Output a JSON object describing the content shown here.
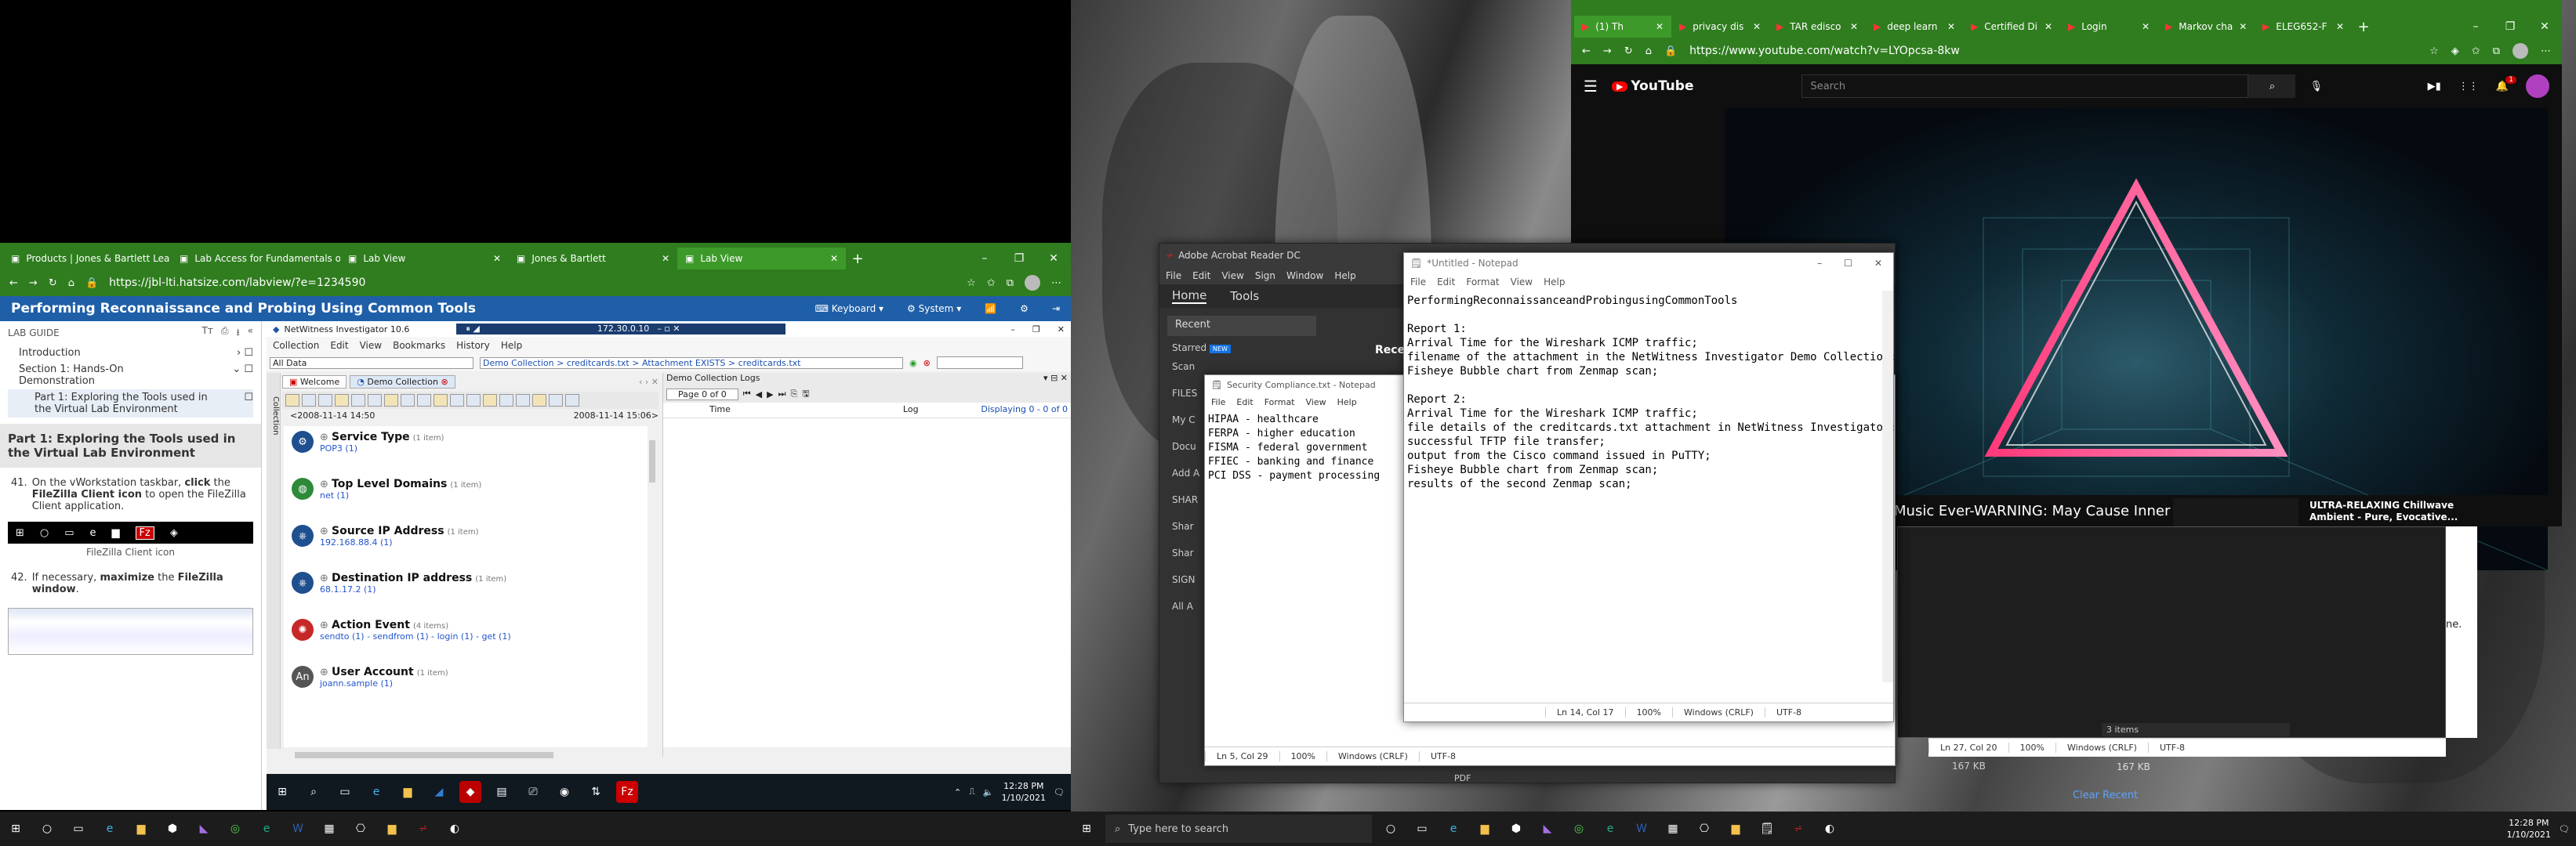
{
  "left_browser": {
    "tabs": [
      {
        "label": "Products | Jones & Bartlett Lea",
        "active": false
      },
      {
        "label": "Lab Access for Fundamentals o",
        "active": false
      },
      {
        "label": "Lab View",
        "active": false
      },
      {
        "label": "Jones & Bartlett",
        "active": false
      },
      {
        "label": "Lab View",
        "active": true
      }
    ],
    "url": "https://jbl-lti.hatsize.com/labview/?e=1234590",
    "page_title": "Performing Reconnaissance and Probing Using Common Tools",
    "keyboard_label": "Keyboard",
    "system_label": "System",
    "lab_guide": {
      "header": "LAB GUIDE",
      "nav": [
        {
          "label": "Introduction"
        },
        {
          "label": "Section 1: Hands-On Demonstration"
        },
        {
          "label": "Part 1: Exploring the Tools used in the Virtual Lab Environment"
        }
      ],
      "section_heading": "Part 1: Exploring the Tools used in the Virtual Lab Environment",
      "step41_num": "41.",
      "step41_a": "On the vWorkstation taskbar, ",
      "step41_b": "click",
      "step41_c": " the ",
      "step41_d": "FileZilla Client icon",
      "step41_e": " to open the FileZilla Client application.",
      "fig_caption": "FileZilla Client icon",
      "step42_num": "42.",
      "step42_a": "If necessary, ",
      "step42_b": "maximize",
      "step42_c": " the ",
      "step42_d": "FileZilla window",
      "step42_e": "."
    }
  },
  "netwitness": {
    "title": "NetWitness Investigator 10.6",
    "remote_ip": "172.30.0.10",
    "menu": [
      "Collection",
      "Edit",
      "View",
      "Bookmarks",
      "History",
      "Help"
    ],
    "filter_value": "All Data",
    "breadcrumb": [
      "Demo Collection",
      "creditcards.txt",
      "Attachment EXISTS",
      "creditcards.txt"
    ],
    "doc_tabs": [
      "Welcome",
      "Demo Collection"
    ],
    "time_start": "2008-11-14 14:50",
    "time_end": "2008-11-14 15:06",
    "page_label": "Page 0 of 0",
    "logs_title": "Demo Collection Logs",
    "log_col_time": "Time",
    "log_col_log": "Log",
    "displaying": "Displaying 0 - 0 of 0",
    "collection_tab": "Collection",
    "meta": [
      {
        "title": "Service Type",
        "count": "(1 item)",
        "values": "POP3 (1)",
        "icon": "gear-icon"
      },
      {
        "title": "Top Level Domains",
        "count": "(1 item)",
        "values": "net (1)",
        "icon": "globe-icon"
      },
      {
        "title": "Source IP Address",
        "count": "(1 item)",
        "values": "192.168.88.4 (1)",
        "icon": "network-icon"
      },
      {
        "title": "Destination IP address",
        "count": "(1 item)",
        "values": "68.1.17.2 (1)",
        "icon": "network-icon"
      },
      {
        "title": "Action Event",
        "count": "(4 items)",
        "values": "sendto (1) - sendfrom (1) - login (1) - get (1)",
        "icon": "event-icon"
      },
      {
        "title": "User Account",
        "count": "(1 item)",
        "values": "joann.sample (1)",
        "icon": "user-icon"
      }
    ]
  },
  "vm_taskbar": {
    "time": "12:28 PM",
    "date": "1/10/2021"
  },
  "host_taskbar": {
    "time": "12:28 PM",
    "date": "1/10/2021",
    "search_placeholder": "Type here to search"
  },
  "right_browser": {
    "tabs": [
      {
        "label": "(1) Th",
        "active": true
      },
      {
        "label": "privacy dis",
        "active": false
      },
      {
        "label": "TAR edisco",
        "active": false
      },
      {
        "label": "deep learn",
        "active": false
      },
      {
        "label": "Certified Di",
        "active": false
      },
      {
        "label": "Login",
        "active": false
      },
      {
        "label": "Markov cha",
        "active": false
      },
      {
        "label": "ELEG652-F",
        "active": false
      }
    ],
    "url": "https://www.youtube.com/watch?v=LYOpcsa-8kw",
    "search_placeholder": "Search",
    "notif_count": "1",
    "brand": "YouTube",
    "video_title": "Music Ever-WARNING: May Cause Inner",
    "side_title_1": "ULTRA-RELAXING Chillwave",
    "side_title_2": "Ambient - Pure, Evocative...",
    "partial_text": "ne."
  },
  "acrobat": {
    "title": "Adobe Acrobat Reader DC",
    "menu": [
      "File",
      "Edit",
      "View",
      "Sign",
      "Window",
      "Help"
    ],
    "nav_home": "Home",
    "nav_tools": "Tools",
    "recent": "Recent",
    "starred": "Starred",
    "new_badge": "NEW",
    "side_items": [
      "Scan",
      "FILES",
      "My C",
      "Docu",
      "Add A",
      "SHAR",
      "Shar",
      "Shar",
      "SIGN",
      "All A"
    ],
    "rec_label": "Rece",
    "pdf_label": "PDF",
    "size_label": "167 KB",
    "clear_recent": "Clear Recent"
  },
  "notepad_security": {
    "title": "Security Compliance.txt - Notepad",
    "menu": [
      "File",
      "Edit",
      "Format",
      "View",
      "Help"
    ],
    "lines": [
      "HIPAA - healthcare",
      "FERPA - higher education",
      "FISMA - federal government",
      "FFIEC - banking and finance",
      "PCI DSS - payment processing"
    ],
    "status": [
      "Ln 5, Col 29",
      "100%",
      "Windows (CRLF)",
      "UTF-8"
    ]
  },
  "notepad_untitled": {
    "title": "*Untitled - Notepad",
    "menu": [
      "File",
      "Edit",
      "Format",
      "View",
      "Help"
    ],
    "lines": [
      "PerformingReconnaissanceandProbingusingCommonTools",
      "",
      "Report 1:",
      "Arrival Time for the Wireshark ICMP traffic;",
      "filename of the attachment in the NetWitness Investigator Demo Collection;",
      "Fisheye Bubble chart from Zenmap scan;",
      "",
      "Report 2:",
      "Arrival Time for the Wireshark ICMP traffic;",
      "file details of the creditcards.txt attachment in NetWitness Investigator;",
      "successful TFTP file transfer;",
      "output from the Cisco command issued in PuTTY;",
      "Fisheye Bubble chart from Zenmap scan;",
      "results of the second Zenmap scan;"
    ],
    "status": [
      "Ln 14, Col 17",
      "100%",
      "Windows (CRLF)",
      "UTF-8"
    ]
  },
  "back_notepad": {
    "status": [
      "Ln 27, Col 20",
      "100%",
      "Windows (CRLF)",
      "UTF-8"
    ],
    "items_label": "3 items"
  }
}
